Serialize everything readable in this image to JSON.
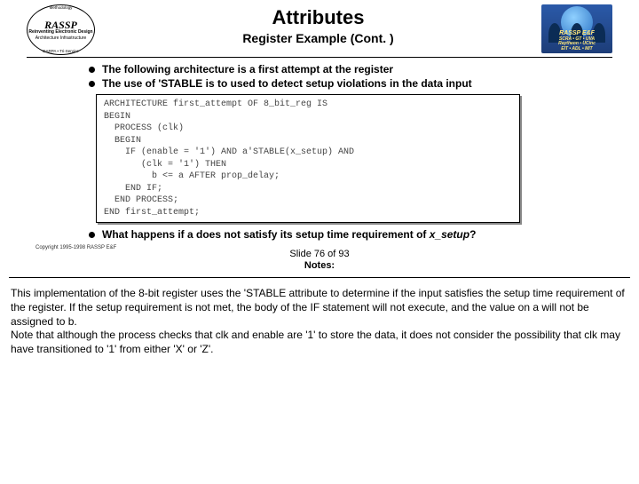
{
  "header": {
    "logo": {
      "top_arch": "Methodology",
      "brand": "RASSP",
      "sub1": "Reinventing\nElectronic\nDesign",
      "sub2": "Architecture  Infrastructure",
      "bot_arch": "DARPA • Tri-Service"
    },
    "title": "Attributes",
    "subtitle": "Register Example (Cont. )",
    "badge": {
      "line1": "RASSP E&F",
      "line2": "SCRA • GT • UVA",
      "line3": "Raytheon • UCinc",
      "line4": "EIT • ADL • MIT"
    }
  },
  "bullets": {
    "b1": "The following architecture is a first attempt at the register",
    "b2": "The use of  'STABLE is to used to detect setup violations in the data input",
    "b3_pre": "What happens if a does not satisfy its setup time requirement of ",
    "b3_em": "x_setup",
    "b3_post": "?"
  },
  "code": "ARCHITECTURE first_attempt OF 8_bit_reg IS\nBEGIN\n  PROCESS (clk)\n  BEGIN\n    IF (enable = '1') AND a'STABLE(x_setup) AND\n       (clk = '1') THEN\n         b <= a AFTER prop_delay;\n    END IF;\n  END PROCESS;\nEND first_attempt;",
  "footer": {
    "left": "Copyright  1995-1998 RASSP E&F",
    "right": ""
  },
  "slide_meta": {
    "position": "Slide 76 of 93",
    "notes_label": "Notes:"
  },
  "notes": {
    "p1": "This implementation of the 8-bit register uses the 'STABLE attribute to determine if the input satisfies the setup time requirement of the register. If the setup requirement is not met, the body of the IF statement will not execute, and the value on a will not be assigned to b.",
    "p2": "Note that although the process checks that clk and enable are '1' to store the data, it does not consider the possibility that clk may have transitioned to '1' from either 'X' or 'Z'."
  }
}
